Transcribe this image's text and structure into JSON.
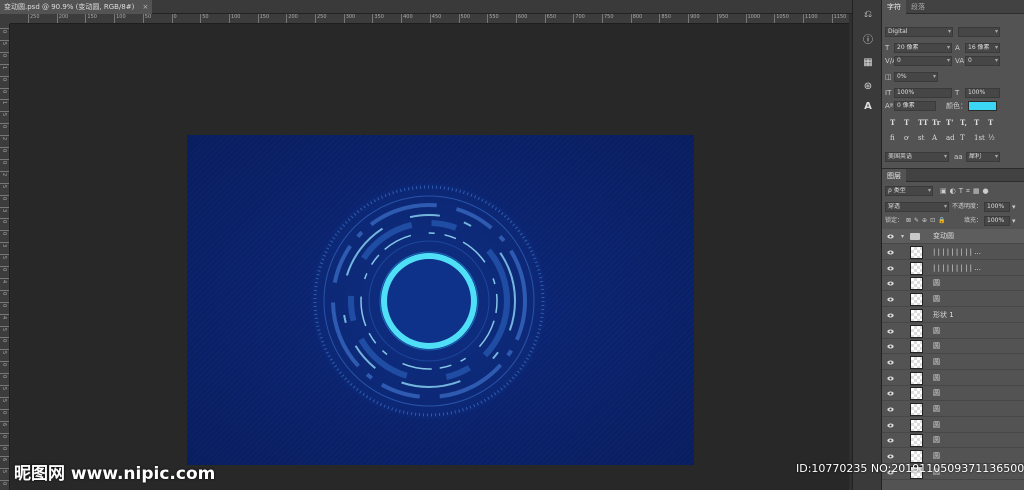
{
  "document": {
    "tab_title": "变动圆.psd @ 90.9% (变动圆, RGB/8#)",
    "close": "×"
  },
  "rulers": {
    "top": [
      "250",
      "200",
      "150",
      "100",
      "50",
      "0",
      "50",
      "100",
      "150",
      "200",
      "250",
      "300",
      "350",
      "400",
      "450",
      "500",
      "550",
      "600",
      "650",
      "700",
      "750",
      "800",
      "850",
      "900",
      "950",
      "1000",
      "1050",
      "1100",
      "1150"
    ],
    "left": [
      "0",
      "5",
      "0",
      "1",
      "0",
      "0",
      "1",
      "5",
      "0",
      "2",
      "0",
      "0",
      "2",
      "5",
      "0",
      "3",
      "0",
      "0",
      "3",
      "5",
      "0",
      "4",
      "0",
      "0",
      "4",
      "5",
      "0",
      "5",
      "0",
      "0",
      "5",
      "5",
      "0",
      "6",
      "0",
      "0",
      "6",
      "5",
      "0"
    ]
  },
  "toolstrip": {
    "icons": [
      {
        "name": "history-icon",
        "glyph": "⎌"
      },
      {
        "name": "info-icon",
        "glyph": "ⓘ"
      },
      {
        "name": "grid-icon",
        "glyph": "▦"
      },
      {
        "name": "paint-icon",
        "glyph": "⊛"
      },
      {
        "name": "character-icon",
        "glyph": "A"
      }
    ]
  },
  "character_panel": {
    "tabs": [
      "字符",
      "段落"
    ],
    "font_family": "Digital",
    "font_size": "20 像素",
    "leading": "16 像素",
    "kerning": "0",
    "tracking": "0",
    "tsume": "0%",
    "vertical_scale": "100%",
    "horizontal_scale": "100%",
    "baseline_shift": "0 像素",
    "color_label": "颜色：",
    "color_value": "#3cd7f5",
    "style_buttons": [
      "T",
      "T",
      "TT",
      "Tr",
      "T'",
      "T,",
      "T",
      "T"
    ],
    "opentype_buttons": [
      "fi",
      "ơ",
      "st",
      "A",
      "ad",
      "T",
      "1st",
      "½"
    ],
    "language": "美国英语",
    "aa_label": "aa",
    "antialias": "犀利"
  },
  "layers_panel": {
    "tabs": [
      "图层"
    ],
    "filter": "ρ 类型",
    "blend_mode": "穿透",
    "opacity_label": "不透明度：",
    "opacity": "100%",
    "lock_label": "锁定：",
    "fill_label": "填充：",
    "fill": "100%",
    "group_name": "变动圆",
    "layers": [
      "| | | | | | | | | ...",
      "| | | | | | | | | ...",
      "圆",
      "圆",
      "形状 1",
      "圆",
      "圆",
      "圆",
      "圆",
      "圆",
      "圆",
      "圆",
      "圆",
      "圆",
      "圆"
    ]
  },
  "watermark": {
    "site": "昵图网 www.nipic.com",
    "id_text": "ID:10770235 NO:20191105093711365000"
  }
}
